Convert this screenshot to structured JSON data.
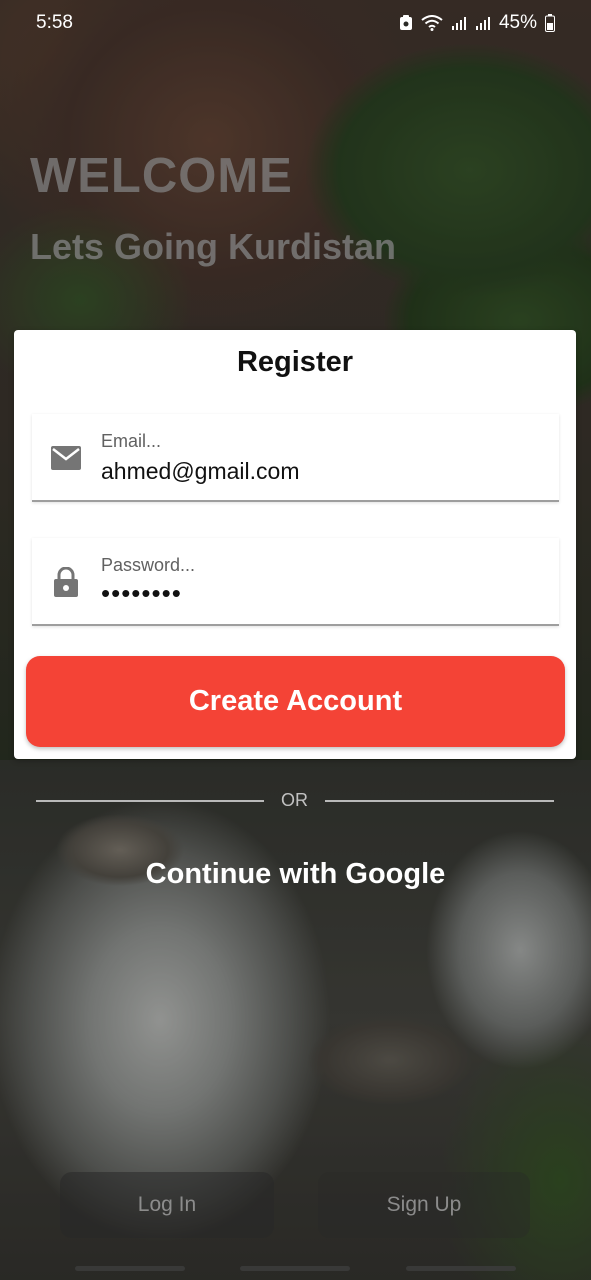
{
  "status_bar": {
    "time": "5:58",
    "battery": "45%"
  },
  "hero": {
    "welcome": "WELCOME",
    "tagline": "Lets Going Kurdistan"
  },
  "register_card": {
    "title": "Register",
    "email": {
      "label": "Email...",
      "value": "ahmed@gmail.com"
    },
    "password": {
      "label": "Password...",
      "value": "••••••••"
    },
    "create_button": "Create Account"
  },
  "divider": {
    "text": "OR"
  },
  "google_button": "Continue with Google",
  "bottom_nav": {
    "login": "Log In",
    "signup": "Sign Up"
  },
  "colors": {
    "accent": "#f44336",
    "card": "#ffffff",
    "icon": "#757575"
  }
}
